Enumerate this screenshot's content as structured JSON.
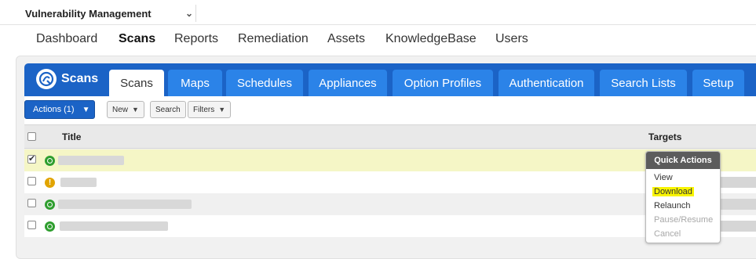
{
  "module": {
    "name": "Vulnerability Management"
  },
  "main_nav": [
    {
      "label": "Dashboard",
      "active": false
    },
    {
      "label": "Scans",
      "active": true
    },
    {
      "label": "Reports",
      "active": false
    },
    {
      "label": "Remediation",
      "active": false
    },
    {
      "label": "Assets",
      "active": false
    },
    {
      "label": "KnowledgeBase",
      "active": false
    },
    {
      "label": "Users",
      "active": false
    }
  ],
  "app": {
    "title": "Scans",
    "icon": "qualys-logo-icon"
  },
  "tabs": [
    {
      "label": "Scans",
      "active": true
    },
    {
      "label": "Maps"
    },
    {
      "label": "Schedules"
    },
    {
      "label": "Appliances"
    },
    {
      "label": "Option Profiles"
    },
    {
      "label": "Authentication"
    },
    {
      "label": "Search Lists"
    },
    {
      "label": "Setup"
    }
  ],
  "toolbar": {
    "actions_label": "Actions (1)",
    "new_label": "New",
    "search_label": "Search",
    "filters_label": "Filters"
  },
  "table": {
    "columns": {
      "title": "Title",
      "targets": "Targets"
    },
    "rows": [
      {
        "checked": true,
        "status": "finished",
        "title_redacted": true
      },
      {
        "checked": false,
        "status": "warning",
        "status_glyph": "!",
        "title_redacted": true
      },
      {
        "checked": false,
        "status": "finished",
        "title_redacted": true
      },
      {
        "checked": false,
        "status": "finished",
        "title_redacted": true
      }
    ]
  },
  "quick_actions": {
    "header": "Quick Actions",
    "items": [
      {
        "label": "View",
        "enabled": true
      },
      {
        "label": "Download",
        "enabled": true,
        "highlighted": true
      },
      {
        "label": "Relaunch",
        "enabled": true
      },
      {
        "label": "Pause/Resume",
        "enabled": false
      },
      {
        "label": "Cancel",
        "enabled": false
      }
    ]
  },
  "colors": {
    "brand_blue": "#1b63c6",
    "tab_blue": "#2b83e8",
    "selected_row": "#f5f6c6",
    "highlight": "#f8f400",
    "status_ok": "#2f9e2f",
    "status_warn": "#e1a400"
  }
}
